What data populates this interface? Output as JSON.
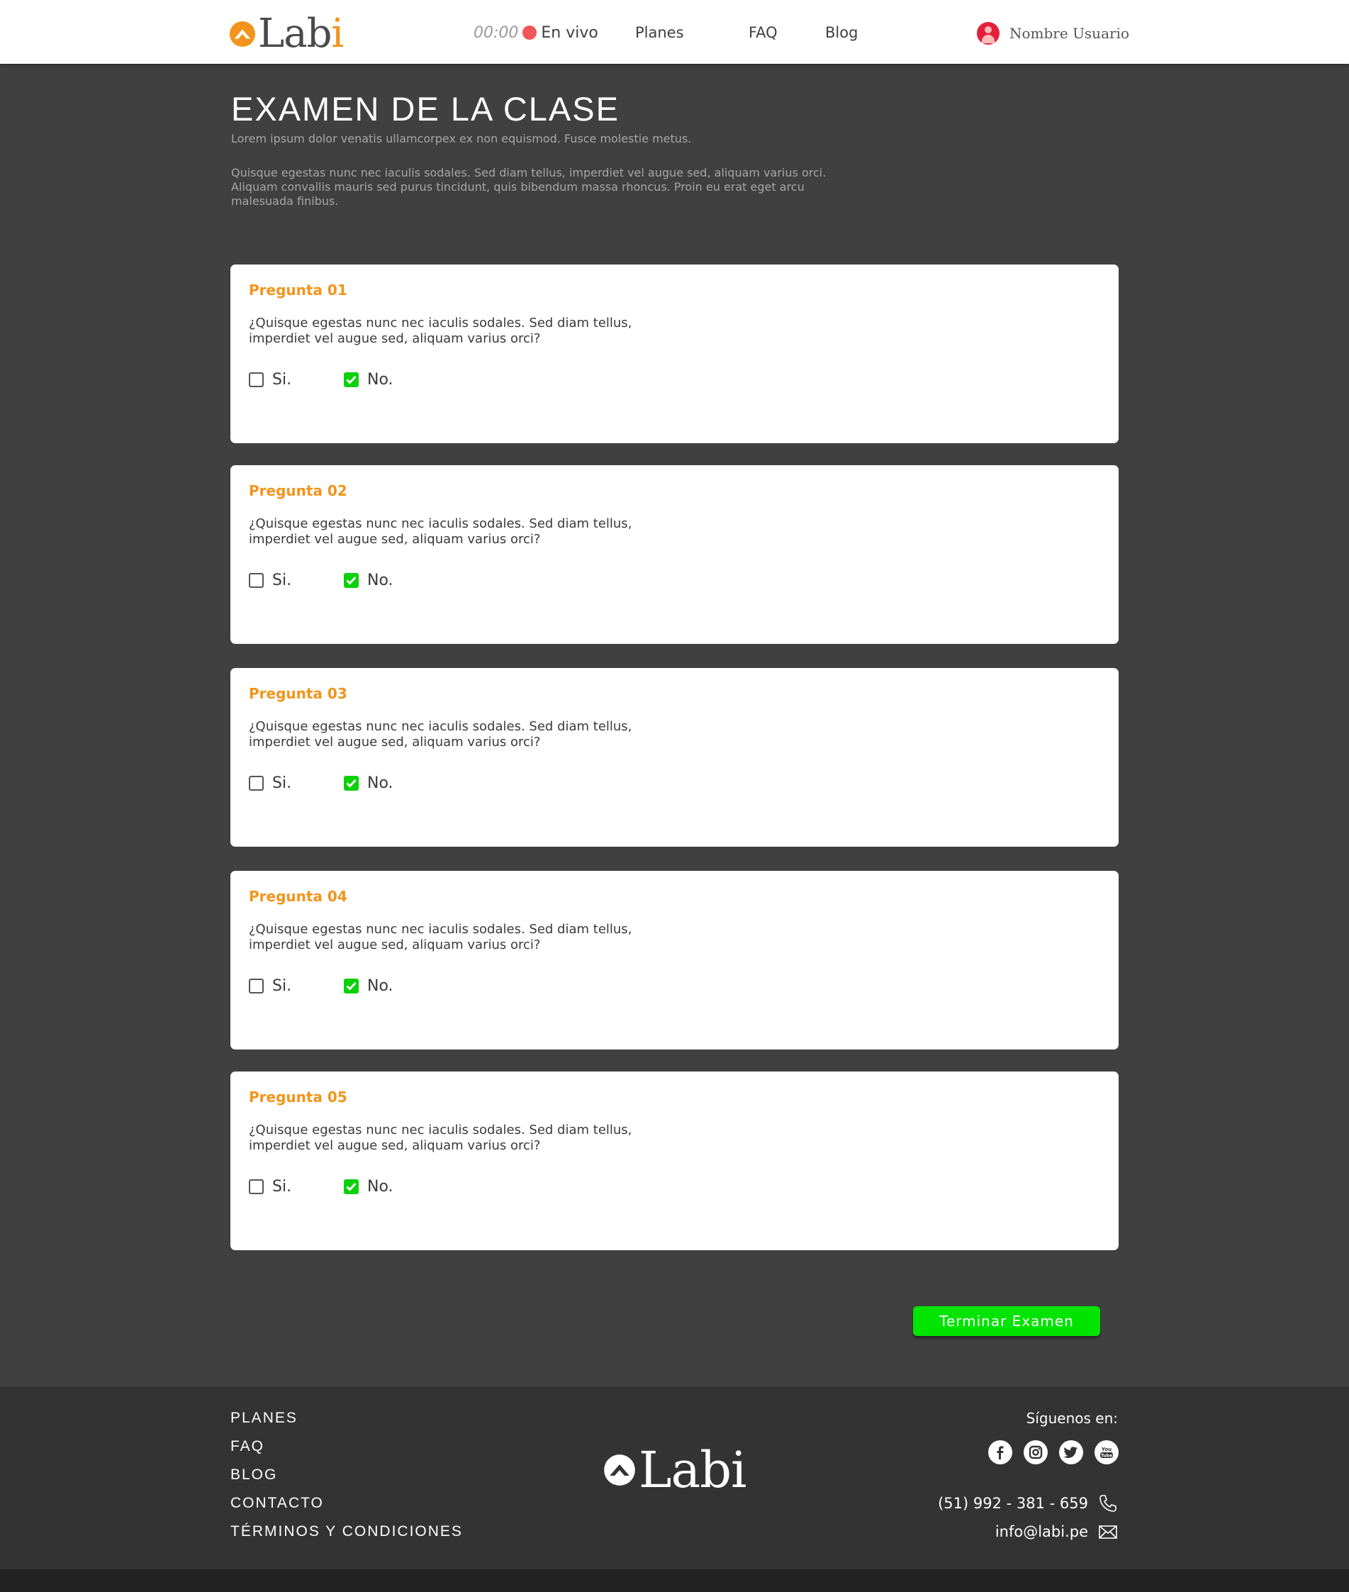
{
  "header": {
    "logo": {
      "main": "Lab",
      "accent": "i"
    },
    "timer": "00:00",
    "live_label": "En vivo",
    "nav": [
      "Planes",
      "FAQ",
      "Blog"
    ],
    "user_name": "Nombre Usuario"
  },
  "main": {
    "title": "EXAMEN DE LA CLASE",
    "subtitle": "Lorem ipsum dolor venatis ullamcorpex ex non equismod. Fusce molestie metus.",
    "description": "Quisque egestas nunc nec iaculis sodales. Sed diam tellus, imperdiet vel augue sed, aliquam varius orci. Aliquam convallis mauris sed purus tincidunt, quis bibendum massa rhoncus. Proin eu erat eget arcu malesuada finibus."
  },
  "questions": [
    {
      "title": "Pregunta 01",
      "text": "¿Quisque egestas nunc nec iaculis sodales. Sed diam tellus, imperdiet vel augue sed, aliquam varius orci?",
      "option_yes": "Si.",
      "option_no": "No.",
      "yes_checked": false,
      "no_checked": true
    },
    {
      "title": "Pregunta 02",
      "text": "¿Quisque egestas nunc nec iaculis sodales. Sed diam tellus, imperdiet vel augue sed, aliquam varius orci?",
      "option_yes": "Si.",
      "option_no": "No.",
      "yes_checked": false,
      "no_checked": true
    },
    {
      "title": "Pregunta 03",
      "text": "¿Quisque egestas nunc nec iaculis sodales. Sed diam tellus, imperdiet vel augue sed, aliquam varius orci?",
      "option_yes": "Si.",
      "option_no": "No.",
      "yes_checked": false,
      "no_checked": true
    },
    {
      "title": "Pregunta 04",
      "text": "¿Quisque egestas nunc nec iaculis sodales. Sed diam tellus, imperdiet vel augue sed, aliquam varius orci?",
      "option_yes": "Si.",
      "option_no": "No.",
      "yes_checked": false,
      "no_checked": true
    },
    {
      "title": "Pregunta 05",
      "text": "¿Quisque egestas nunc nec iaculis sodales. Sed diam tellus, imperdiet vel augue sed, aliquam varius orci?",
      "option_yes": "Si.",
      "option_no": "No.",
      "yes_checked": false,
      "no_checked": true
    }
  ],
  "finish_button": "Terminar Examen",
  "footer": {
    "links": [
      "PLANES",
      "FAQ",
      "BLOG",
      "CONTACTO",
      "TÉRMINOS Y CONDICIONES"
    ],
    "logo_text": "Labi",
    "follow_label": "Síguenos en:",
    "social": [
      "facebook-icon",
      "instagram-icon",
      "twitter-icon",
      "youtube-icon"
    ],
    "phone": "(51) 992 - 381 - 659",
    "email": "info@labi.pe"
  },
  "colors": {
    "accent": "#f2941b",
    "live": "#f0555a",
    "check": "#0bd10b",
    "button": "#00e400",
    "background": "#404040",
    "footer": "#333333"
  }
}
